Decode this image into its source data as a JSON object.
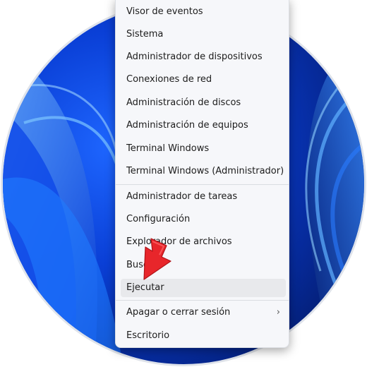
{
  "menu": {
    "items": [
      {
        "label": "Visor de eventos"
      },
      {
        "label": "Sistema"
      },
      {
        "label": "Administrador de dispositivos"
      },
      {
        "label": "Conexiones de red"
      },
      {
        "label": "Administración de discos"
      },
      {
        "label": "Administración de equipos"
      },
      {
        "label": "Terminal Windows"
      },
      {
        "label": "Terminal Windows (Administrador)"
      },
      {
        "label": "Administrador de tareas"
      },
      {
        "label": "Configuración"
      },
      {
        "label": "Explorador de archivos"
      },
      {
        "label": "Buscar"
      },
      {
        "label": "Ejecutar"
      },
      {
        "label": "Apagar o cerrar sesión",
        "submenu_icon": "chevron-right-icon"
      },
      {
        "label": "Escritorio"
      }
    ],
    "highlighted_item": "Ejecutar"
  },
  "annotation": {
    "icon": "red-arrow-icon",
    "color": "#e8262b"
  },
  "colors": {
    "wallpaper_blue": "#0a3fd6",
    "menu_bg": "#f6f7fa",
    "hover_bg": "#e8e9ec"
  }
}
